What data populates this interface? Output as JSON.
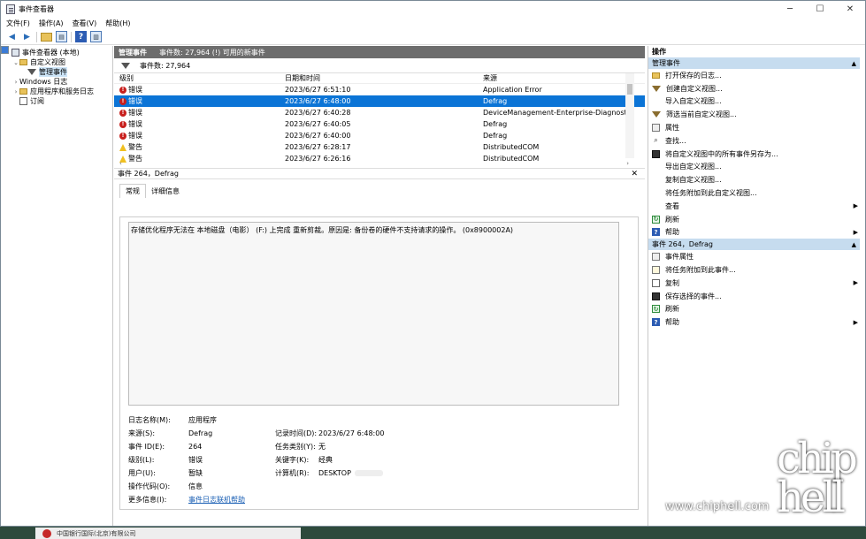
{
  "window": {
    "title": "事件查看器",
    "controls": {
      "minimize": "─",
      "maximize": "☐",
      "close": "✕"
    }
  },
  "menu": [
    "文件(F)",
    "操作(A)",
    "查看(V)",
    "帮助(H)"
  ],
  "tree": [
    {
      "label": "事件查看器 (本地)",
      "expander": "",
      "icon": "computer-icon",
      "indent": 0
    },
    {
      "label": "自定义视图",
      "expander": "⌄",
      "icon": "folder-icon",
      "indent": 1
    },
    {
      "label": "管理事件",
      "expander": "",
      "icon": "filter-icon",
      "indent": 2,
      "selected": true
    },
    {
      "label": "Windows 日志",
      "expander": "›",
      "icon": "windows-log-icon",
      "indent": 1
    },
    {
      "label": "应用程序和服务日志",
      "expander": "›",
      "icon": "folder-icon",
      "indent": 1
    },
    {
      "label": "订阅",
      "expander": "",
      "icon": "subscription-icon",
      "indent": 1
    }
  ],
  "center": {
    "header_title": "管理事件",
    "header_info": "事件数: 27,964 (!) 可用的新事件",
    "filter_text": "事件数: 27,964",
    "columns": [
      "级别",
      "日期和时间",
      "来源"
    ],
    "events": [
      {
        "level": "错误",
        "type": "error",
        "datetime": "2023/6/27 6:51:10",
        "source": "Application Error"
      },
      {
        "level": "错误",
        "type": "error",
        "datetime": "2023/6/27 6:48:00",
        "source": "Defrag",
        "selected": true
      },
      {
        "level": "错误",
        "type": "error",
        "datetime": "2023/6/27 6:40:28",
        "source": "DeviceManagement-Enterprise-Diagnostics-Pr..."
      },
      {
        "level": "错误",
        "type": "error",
        "datetime": "2023/6/27 6:40:05",
        "source": "Defrag"
      },
      {
        "level": "错误",
        "type": "error",
        "datetime": "2023/6/27 6:40:00",
        "source": "Defrag"
      },
      {
        "level": "警告",
        "type": "warning",
        "datetime": "2023/6/27 6:28:17",
        "source": "DistributedCOM"
      },
      {
        "level": "警告",
        "type": "warning",
        "datetime": "2023/6/27 6:26:16",
        "source": "DistributedCOM"
      }
    ],
    "scroll": {
      "left": "‹",
      "right": "›",
      "up": "˄",
      "down": "˅"
    }
  },
  "detail": {
    "title": "事件 264，Defrag",
    "close": "✕",
    "tabs": [
      "常规",
      "详细信息"
    ],
    "message": "存储优化程序无法在 本地磁盘（电影） (F:) 上完成 重新剪裁。原因是: 备份卷的硬件不支持请求的操作。 (0x8900002A)",
    "props": {
      "log_name_label": "日志名称(M):",
      "log_name": "应用程序",
      "source_label": "来源(S):",
      "source": "Defrag",
      "logged_label": "记录时间(D):",
      "logged": "2023/6/27 6:48:00",
      "event_id_label": "事件 ID(E):",
      "event_id": "264",
      "task_label": "任务类别(Y):",
      "task": "无",
      "level_label": "级别(L):",
      "level": "错误",
      "keywords_label": "关键字(K):",
      "keywords": "经典",
      "user_label": "用户(U):",
      "user": "暂缺",
      "computer_label": "计算机(R):",
      "computer": "DESKTOP",
      "opcode_label": "操作代码(O):",
      "opcode": "信息",
      "more_label": "更多信息(I):",
      "more_link": "事件日志联机帮助"
    }
  },
  "actions": {
    "title": "操作",
    "section1": "管理事件",
    "section1_items": [
      {
        "label": "打开保存的日志...",
        "icon": "open-log-icon",
        "more": ""
      },
      {
        "label": "创建自定义视图...",
        "icon": "create-view-icon",
        "more": ""
      },
      {
        "label": "导入自定义视图...",
        "icon": "",
        "more": ""
      },
      {
        "label": "筛选当前自定义视图...",
        "icon": "filter-icon",
        "more": ""
      },
      {
        "label": "属性",
        "icon": "properties-icon",
        "more": ""
      },
      {
        "label": "查找...",
        "icon": "find-icon",
        "more": ""
      },
      {
        "label": "将自定义视图中的所有事件另存为...",
        "icon": "save-icon",
        "more": ""
      },
      {
        "label": "导出自定义视图...",
        "icon": "",
        "more": ""
      },
      {
        "label": "复制自定义视图...",
        "icon": "",
        "more": ""
      },
      {
        "label": "将任务附加到此自定义视图...",
        "icon": "",
        "more": ""
      },
      {
        "label": "查看",
        "icon": "",
        "more": "▶"
      },
      {
        "label": "刷新",
        "icon": "refresh-icon",
        "more": ""
      },
      {
        "label": "帮助",
        "icon": "help-icon",
        "more": "▶"
      }
    ],
    "section2": "事件 264，Defrag",
    "section2_items": [
      {
        "label": "事件属性",
        "icon": "event-properties-icon",
        "more": ""
      },
      {
        "label": "将任务附加到此事件...",
        "icon": "attach-task-icon",
        "more": ""
      },
      {
        "label": "复制",
        "icon": "copy-icon",
        "more": "▶"
      },
      {
        "label": "保存选择的事件...",
        "icon": "save-icon",
        "more": ""
      },
      {
        "label": "刷新",
        "icon": "refresh-icon",
        "more": ""
      },
      {
        "label": "帮助",
        "icon": "help-icon",
        "more": "▶"
      }
    ],
    "collapse": "▲"
  },
  "taskbar_text": "中国银行国际(北京)有限公司",
  "watermark": {
    "text": "www.chiphell.com",
    "logo": "chip hell"
  }
}
